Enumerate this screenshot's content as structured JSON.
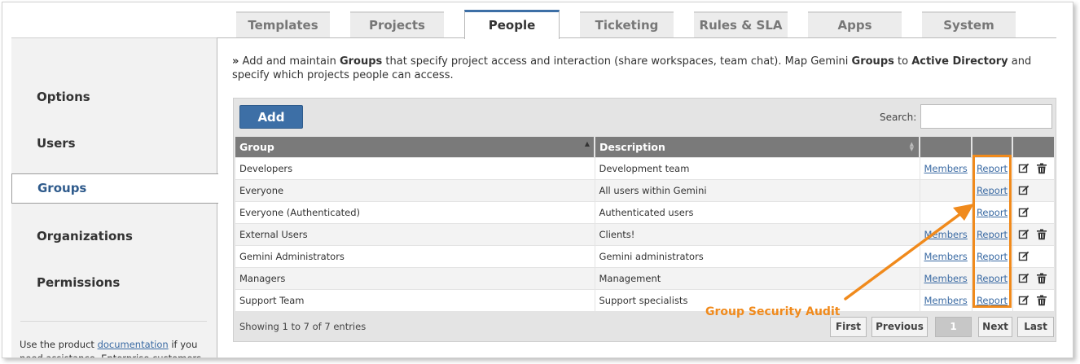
{
  "tabs": [
    "Templates",
    "Projects",
    "People",
    "Ticketing",
    "Rules & SLA",
    "Apps",
    "System"
  ],
  "active_tab": "People",
  "sidebar": {
    "items": [
      "Options",
      "Users",
      "Groups",
      "Organizations",
      "Permissions"
    ],
    "active": "Groups",
    "note_prefix": "Use the product ",
    "note_link": "documentation",
    "note_suffix": " if you need assistance. Enterprise customers"
  },
  "intro": {
    "marker": "»",
    "t1": " Add and maintain ",
    "b1": "Groups",
    "t2": " that specify project access and interaction (share workspaces, team chat). Map Gemini ",
    "b2": "Groups",
    "t3": " to ",
    "b3": "Active Directory",
    "t4": " and specify which projects people can access."
  },
  "toolbar": {
    "add_label": "Add",
    "search_label": "Search:",
    "search_value": ""
  },
  "table": {
    "columns": [
      "Group",
      "Description",
      "",
      "",
      ""
    ],
    "rows": [
      {
        "group": "Developers",
        "description": "Development team",
        "members": "Members",
        "report": "Report",
        "edit": true,
        "delete": true
      },
      {
        "group": "Everyone",
        "description": "All users within Gemini",
        "members": "",
        "report": "Report",
        "edit": true,
        "delete": false
      },
      {
        "group": "Everyone (Authenticated)",
        "description": "Authenticated users",
        "members": "",
        "report": "Report",
        "edit": true,
        "delete": false
      },
      {
        "group": "External Users",
        "description": "Clients!",
        "members": "Members",
        "report": "Report",
        "edit": true,
        "delete": true
      },
      {
        "group": "Gemini Administrators",
        "description": "Gemini administrators",
        "members": "Members",
        "report": "Report",
        "edit": true,
        "delete": false
      },
      {
        "group": "Managers",
        "description": "Management",
        "members": "Members",
        "report": "Report",
        "edit": true,
        "delete": true
      },
      {
        "group": "Support Team",
        "description": "Support specialists",
        "members": "Members",
        "report": "Report",
        "edit": true,
        "delete": true
      }
    ]
  },
  "footer": {
    "showing": "Showing 1 to 7 of 7 entries",
    "pager": {
      "first": "First",
      "previous": "Previous",
      "page": "1",
      "next": "Next",
      "last": "Last"
    }
  },
  "annotation": {
    "label": "Group Security Audit",
    "color": "#f08a1c"
  },
  "colors": {
    "accent": "#3d6fa6",
    "header_bg": "#7a7a7a",
    "link": "#3a6aa3"
  }
}
